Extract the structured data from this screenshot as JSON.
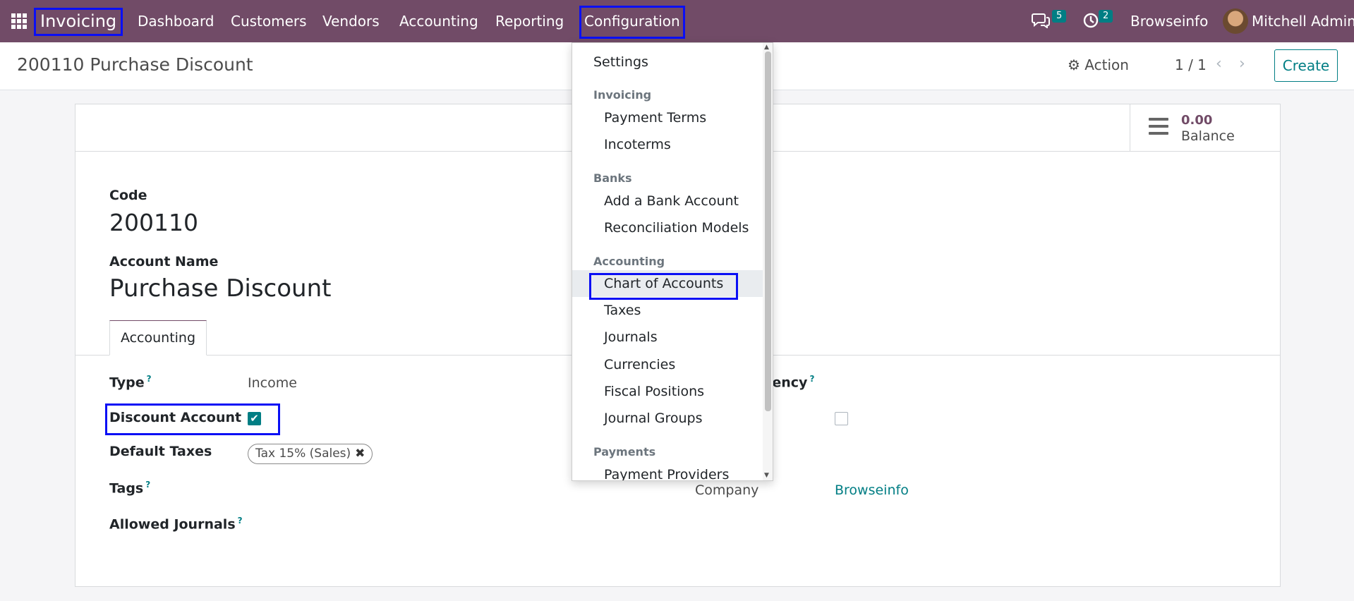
{
  "navbar": {
    "app_name": "Invoicing",
    "menus": [
      "Dashboard",
      "Customers",
      "Vendors",
      "Accounting",
      "Reporting",
      "Configuration"
    ],
    "chat_count": "5",
    "activity_count": "2",
    "company": "Browseinfo",
    "user": "Mitchell Admin"
  },
  "control": {
    "breadcrumb": "200110 Purchase Discount",
    "action_label": "Action",
    "pager": "1 / 1",
    "create_label": "Create"
  },
  "stat": {
    "value": "0.00",
    "label": "Balance"
  },
  "form": {
    "code_label": "Code",
    "code_value": "200110",
    "name_label": "Account Name",
    "name_value": "Purchase Discount",
    "tab_label": "Accounting",
    "type_label": "Type",
    "type_help": "?",
    "type_value": "Income",
    "currency_label_visible": "rency",
    "currency_help": "?",
    "discount_label": "Discount Account",
    "discount_checked": true,
    "default_taxes_label": "Default Taxes",
    "tax_tag": "Tax 15% (Sales)",
    "tags_label": "Tags",
    "tags_help": "?",
    "allowed_journals_label": "Allowed Journals",
    "allowed_journals_help": "?",
    "company_label": "Company",
    "company_value": "Browseinfo"
  },
  "dropdown": {
    "settings": "Settings",
    "sections": [
      {
        "header": "Invoicing",
        "items": [
          "Payment Terms",
          "Incoterms"
        ]
      },
      {
        "header": "Banks",
        "items": [
          "Add a Bank Account",
          "Reconciliation Models"
        ]
      },
      {
        "header": "Accounting",
        "items": [
          "Chart of Accounts",
          "Taxes",
          "Journals",
          "Currencies",
          "Fiscal Positions",
          "Journal Groups"
        ]
      },
      {
        "header": "Payments",
        "items": [
          "Payment Providers"
        ]
      }
    ],
    "active_item": "Chart of Accounts"
  },
  "colors": {
    "navbar": "#714b67",
    "accent": "#017e84",
    "highlight": "#0a0ff5"
  },
  "icons": [
    "apps-grid-icon",
    "chat-icon",
    "clock-icon",
    "gear-icon",
    "chevron-left-icon",
    "chevron-right-icon",
    "list-icon",
    "check-icon",
    "close-icon"
  ]
}
